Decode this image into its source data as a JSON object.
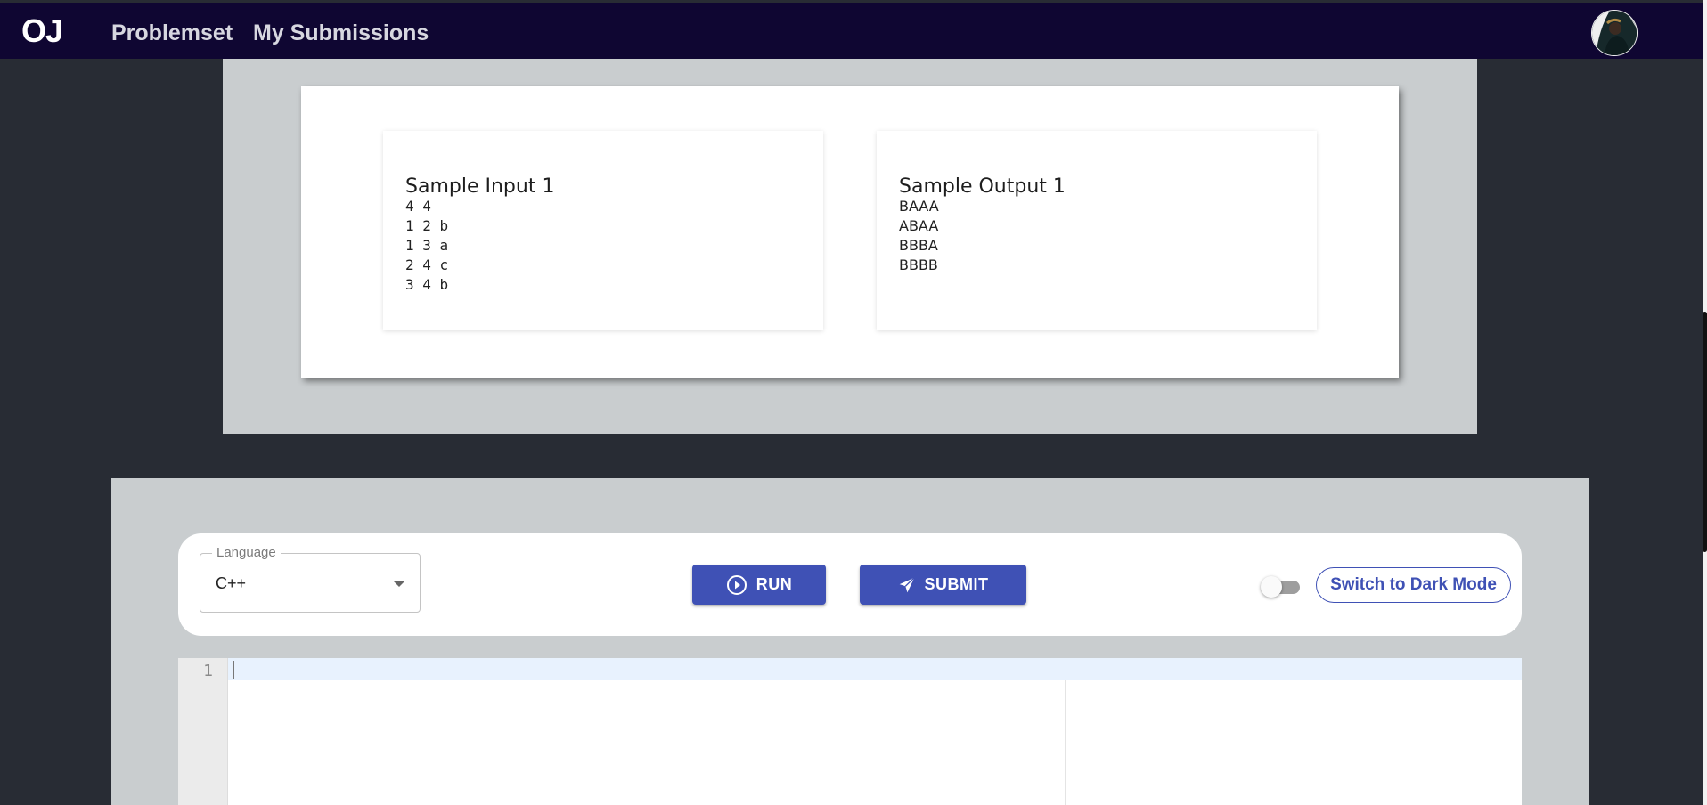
{
  "navbar": {
    "logo": "OJ",
    "links": [
      "Problemset",
      "My Submissions"
    ]
  },
  "samples": {
    "input": {
      "title": "Sample Input 1",
      "body": "4 4\n1 2 b\n1 3 a\n2 4 c\n3 4 b"
    },
    "output": {
      "title": "Sample Output 1",
      "body": "BAAA\nABAA\nBBBA\nBBBB"
    }
  },
  "toolbar": {
    "language_label": "Language",
    "language_value": "C++",
    "run_label": "RUN",
    "submit_label": "SUBMIT",
    "dark_mode_label": "Switch to Dark Mode",
    "dark_mode_on": false
  },
  "editor": {
    "line_numbers": [
      "1"
    ]
  },
  "colors": {
    "navbar": "#0f0632",
    "accent": "#3f51b5",
    "page_background": "#282c34",
    "panel": "#c9cdcf"
  }
}
